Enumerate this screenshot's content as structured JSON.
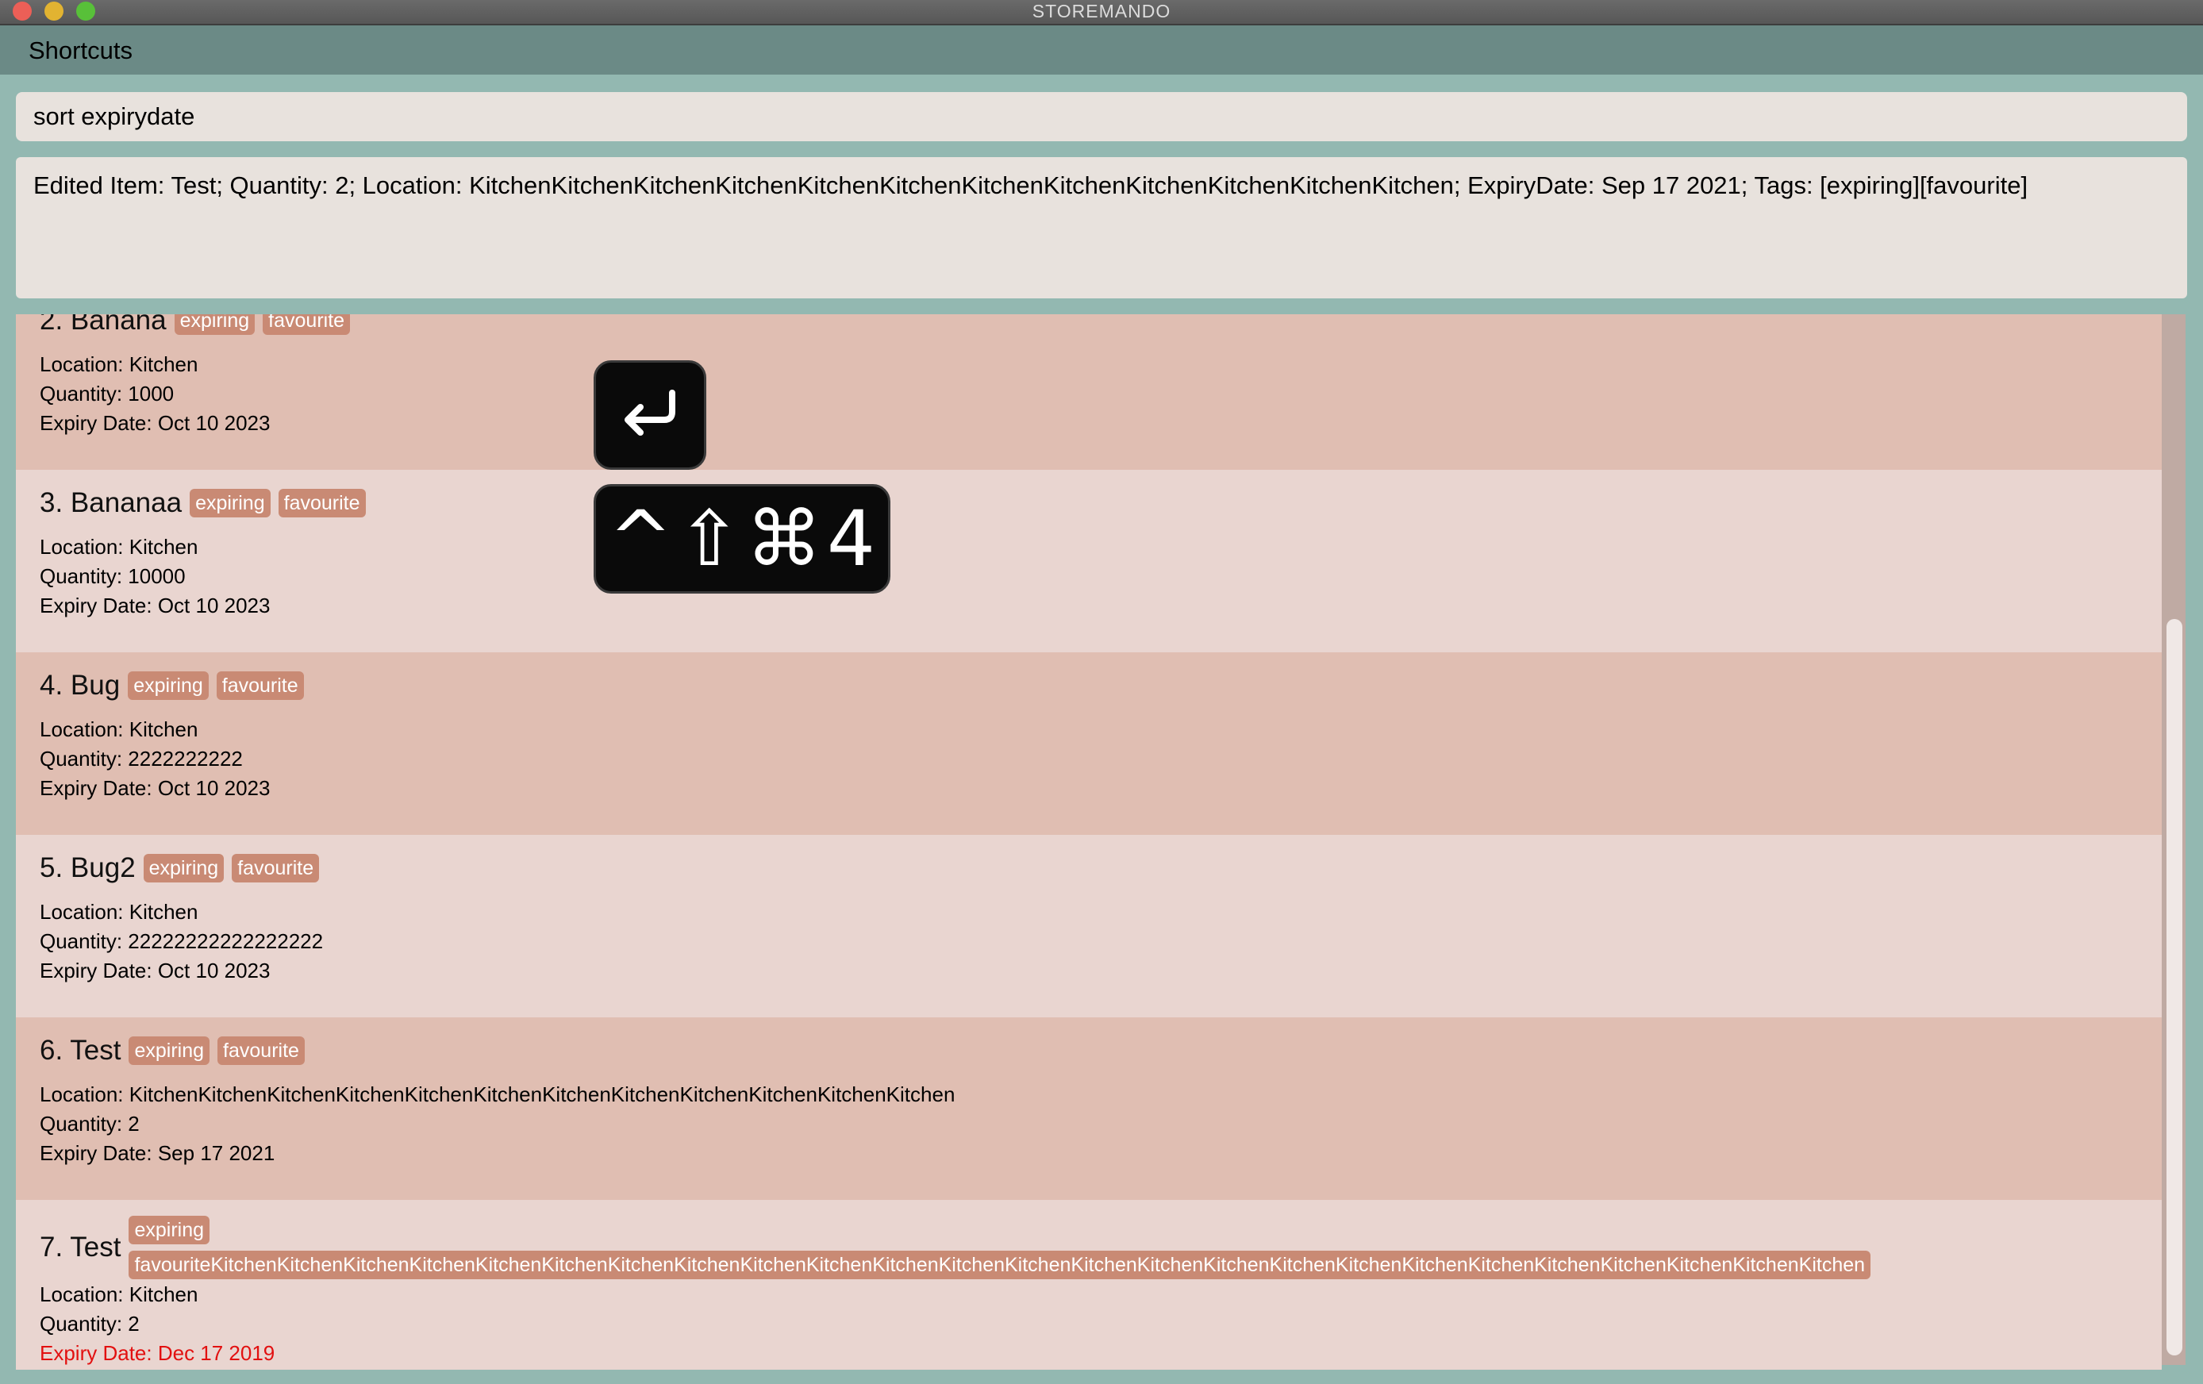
{
  "window": {
    "title": "STOREMANDO"
  },
  "menu": {
    "shortcuts_label": "Shortcuts"
  },
  "command_box": {
    "value": "sort expirydate"
  },
  "result_box": {
    "text": "Edited Item: Test; Quantity: 2; Location: KitchenKitchenKitchenKitchenKitchenKitchenKitchenKitchenKitchenKitchenKitchenKitchen; ExpiryDate: Sep 17 2021; Tags: [expiring][favourite]"
  },
  "items": [
    {
      "title": "2. Banana",
      "tags": [
        "expiring",
        "favourite"
      ],
      "location": "Location: Kitchen",
      "quantity": "Quantity: 1000",
      "expiry": "Expiry Date: Oct 10 2023"
    },
    {
      "title": "3. Bananaa",
      "tags": [
        "expiring",
        "favourite"
      ],
      "location": "Location: Kitchen",
      "quantity": "Quantity: 10000",
      "expiry": "Expiry Date: Oct 10 2023"
    },
    {
      "title": "4. Bug",
      "tags": [
        "expiring",
        "favourite"
      ],
      "location": "Location: Kitchen",
      "quantity": "Quantity: 2222222222",
      "expiry": "Expiry Date: Oct 10 2023"
    },
    {
      "title": "5. Bug2",
      "tags": [
        "expiring",
        "favourite"
      ],
      "location": "Location: Kitchen",
      "quantity": "Quantity: 22222222222222222",
      "expiry": "Expiry Date: Oct 10 2023"
    },
    {
      "title": "6. Test",
      "tags": [
        "expiring",
        "favourite"
      ],
      "location": "Location: KitchenKitchenKitchenKitchenKitchenKitchenKitchenKitchenKitchenKitchenKitchenKitchen",
      "quantity": "Quantity: 2",
      "expiry": "Expiry Date: Sep 17 2021"
    },
    {
      "title": "7. Test",
      "tags": [
        "expiring",
        "favouriteKitchenKitchenKitchenKitchenKitchenKitchenKitchenKitchenKitchenKitchenKitchenKitchenKitchenKitchenKitchenKitchenKitchenKitchenKitchenKitchenKitchenKitchenKitchenKitchenKitchen"
      ],
      "location": "Location: Kitchen",
      "quantity": "Quantity: 2",
      "expiry": "Expiry Date: Dec 17 2019"
    }
  ],
  "keystroke_overlay": {
    "enter_icon": "return-arrow-icon",
    "combo_keys": [
      "^",
      "⇧",
      "⌘",
      "4"
    ]
  },
  "colors": {
    "card_dark": "#e0beb2",
    "card_light": "#e9d5d0",
    "tag": "#c98a74",
    "expired_text": "#e21010",
    "background": "#93b8b1",
    "menubar": "#6b8a86"
  }
}
